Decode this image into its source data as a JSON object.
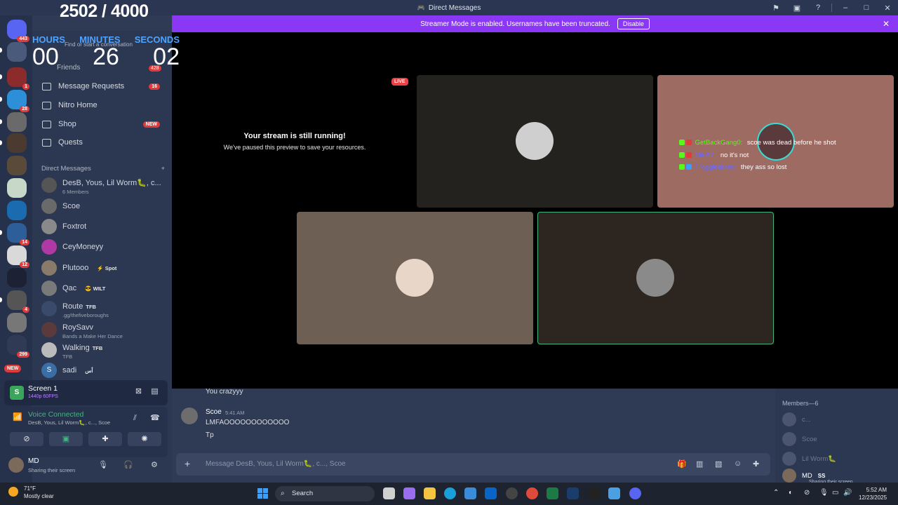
{
  "window": {
    "title": "Direct Messages"
  },
  "overlay": {
    "counter": "2502 / 4000",
    "labels": [
      "HOURS",
      "MINUTES",
      "SECONDS"
    ],
    "values": [
      "00",
      "26",
      "02"
    ]
  },
  "banner": {
    "text": "Streamer Mode is enabled. Usernames have been truncated.",
    "button": "Disable"
  },
  "rail": {
    "badges": [
      "443",
      "1",
      "28",
      "14",
      "12",
      "4",
      "299"
    ],
    "new_label": "NEW"
  },
  "sidebar": {
    "find_placeholder": "Find or start a conversation",
    "friends": {
      "label": "Friends",
      "badge": "428"
    },
    "nav": [
      {
        "label": "Message Requests",
        "pill": "16"
      },
      {
        "label": "Nitro Home",
        "pill": ""
      },
      {
        "label": "Shop",
        "pill": "NEW"
      },
      {
        "label": "Quests",
        "pill": ""
      }
    ],
    "dm_header": "Direct Messages",
    "dms": [
      {
        "name": "DesB, Yous, Lil Worm🐛, c...",
        "sub": "6 Members",
        "tag": ""
      },
      {
        "name": "Scoe",
        "sub": "",
        "tag": ""
      },
      {
        "name": "Foxtrot",
        "sub": "",
        "tag": ""
      },
      {
        "name": "CeyMoneyy",
        "sub": "",
        "tag": ""
      },
      {
        "name": "Plutooo",
        "sub": "",
        "tag": "⚡ Spot"
      },
      {
        "name": "Qac",
        "sub": "",
        "tag": "😎 WILT"
      },
      {
        "name": "Route",
        "sub": ".gg/thefiveboroughs",
        "tag": "TFB"
      },
      {
        "name": "RoySavv",
        "sub": "Bands a Make Her Dance",
        "tag": ""
      },
      {
        "name": "Walking",
        "sub": "TFB",
        "tag": "TFB"
      },
      {
        "name": "sadi",
        "sub": "",
        "tag": "أس"
      }
    ]
  },
  "screen_share": {
    "title": "Screen 1",
    "quality": "1440p 60FPS"
  },
  "voice": {
    "status": "Voice Connected",
    "channel": "DesB, Yous, Lil Worm🐛, c..., Scoe"
  },
  "user": {
    "name": "MD",
    "status": "Sharing their screen"
  },
  "stage": {
    "live": "LIVE",
    "paused_title": "Your stream is still running!",
    "paused_sub": "We've paused this preview to save your resources.",
    "overlay_chat": [
      {
        "who": "GetBackGang0:",
        "text": "scoe was dead before he shot",
        "color": "#53fc18"
      },
      {
        "who": "Nilo97:",
        "text": "no it's not",
        "color": "#6b6bff"
      },
      {
        "who": "Froggiesbrett:",
        "text": "they ass so lost",
        "color": "#6b6bff"
      }
    ]
  },
  "chat": {
    "prev_line": "You crazyyy",
    "author": "Scoe",
    "time": "5:41 AM",
    "lines": [
      "LMFAOOOOOOOOOOOO",
      "Tp"
    ],
    "composer_placeholder": "Message DesB, Yous, Lil Worm🐛, c..., Scoe"
  },
  "members": {
    "header": "Members—6",
    "list": [
      "c...",
      "Scoe",
      "Lil Worm🐛",
      "MD"
    ],
    "md_tag": "SS",
    "md_sub": "Sharing their screen"
  },
  "taskbar": {
    "temp": "71°F",
    "weather": "Mostly clear",
    "search": "Search",
    "time": "5:52 AM",
    "date": "12/23/2025"
  }
}
